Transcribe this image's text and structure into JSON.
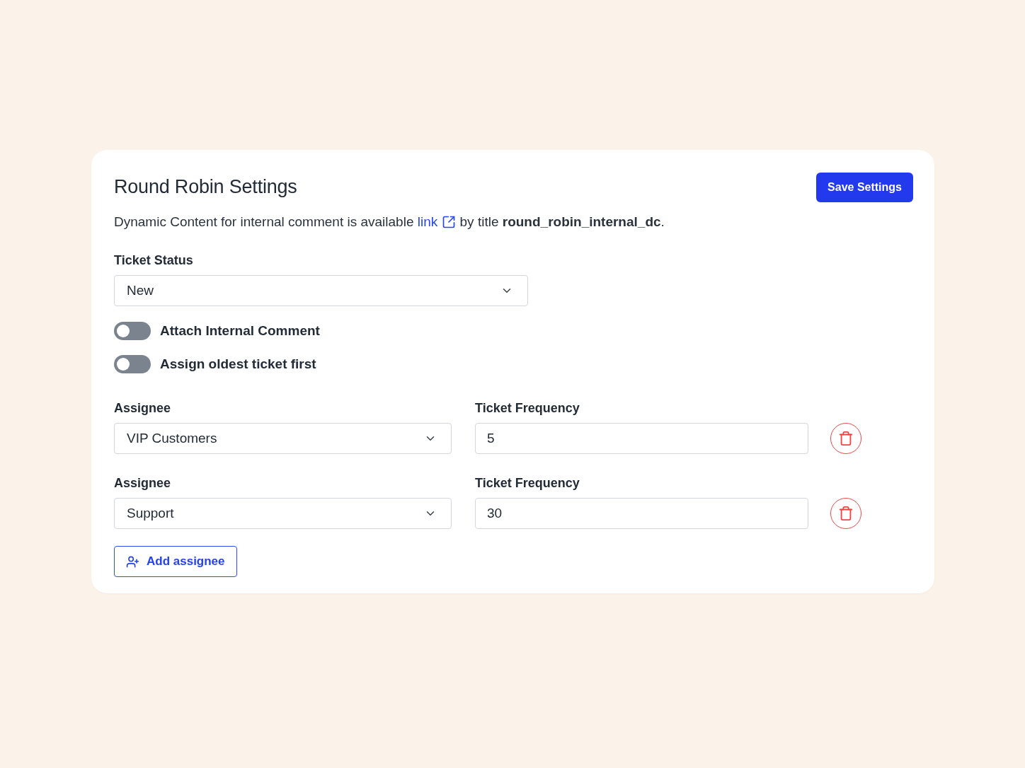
{
  "card": {
    "title": "Round Robin Settings",
    "save_button": "Save Settings",
    "description": {
      "text_before": "Dynamic Content for internal comment is available",
      "link": "link",
      "text_after": "by title **round_robin_internal_dc**."
    },
    "ticket_status": {
      "label": "Ticket Status",
      "value": "New"
    },
    "toggles": [
      {
        "label": "Attach Internal Comment",
        "on": false
      },
      {
        "label": "Assign oldest ticket first",
        "on": false
      }
    ],
    "assignees": [
      {
        "assignee_label": "Assignee",
        "assignee": "VIP Customers",
        "frequency_label": "Ticket Frequency",
        "frequency": "5"
      },
      {
        "assignee_label": "Assignee",
        "assignee": "Support",
        "frequency_label": "Ticket Frequency",
        "frequency": "30"
      }
    ],
    "add_button": "Add assignee"
  }
}
